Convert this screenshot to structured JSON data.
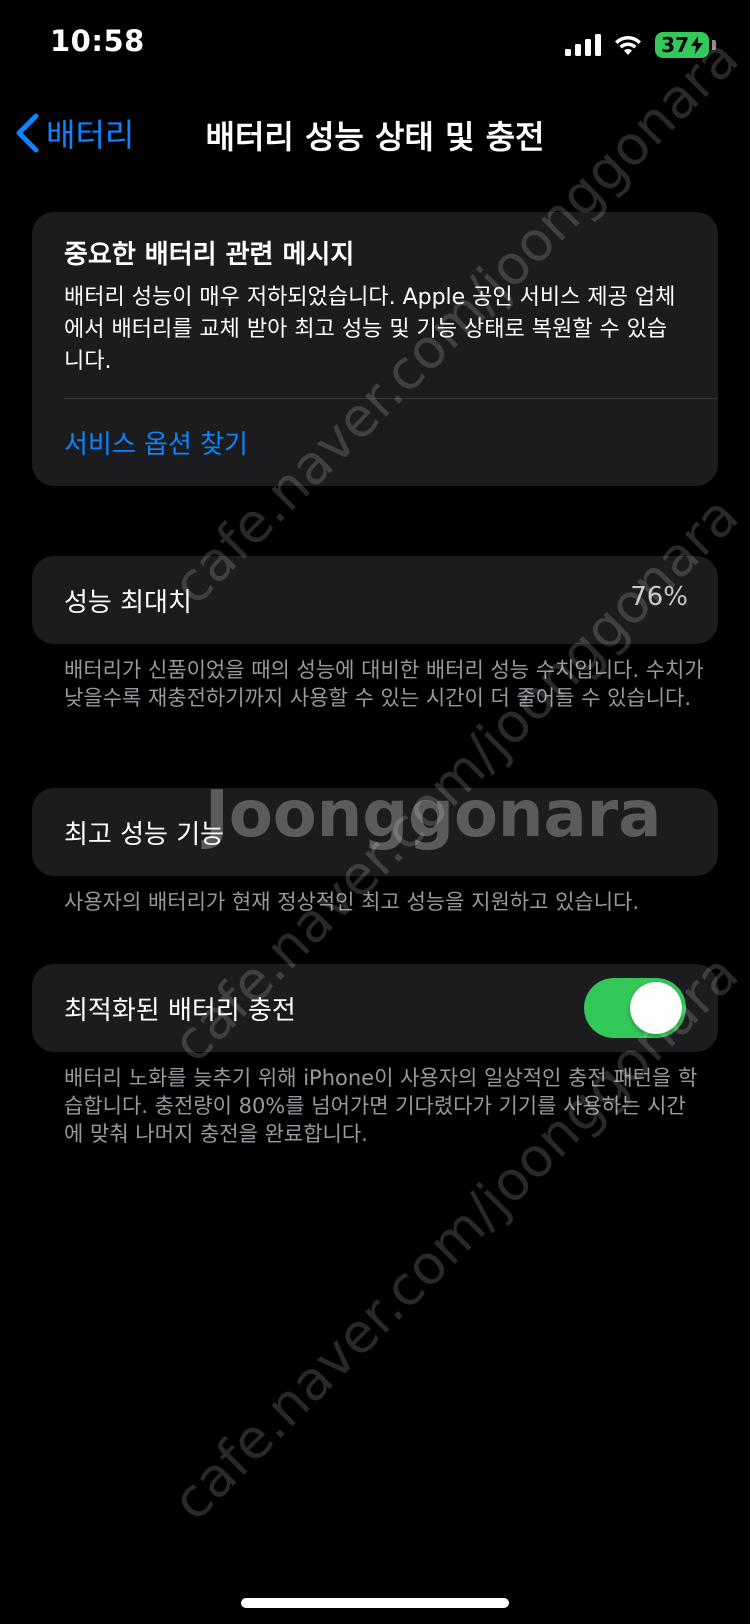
{
  "status_bar": {
    "time": "10:58",
    "battery_percent": "37"
  },
  "nav": {
    "back_label": "배터리",
    "title": "배터리 성능 상태 및 충전"
  },
  "message_card": {
    "title": "중요한 배터리 관련 메시지",
    "body": "배터리 성능이 매우 저하되었습니다. Apple 공인 서비스 제공 업체에서 배터리를 교체 받아 최고 성능 및 기능 상태로 복원할 수 있습니다.",
    "link": "서비스 옵션 찾기"
  },
  "max_capacity": {
    "label": "성능 최대치",
    "value": "76%",
    "footnote": "배터리가 신품이었을 때의 성능에 대비한 배터리 성능 수치입니다. 수치가 낮을수록 재충전하기까지 사용할 수 있는 시간이 더 줄어들 수 있습니다."
  },
  "peak_performance": {
    "label": "최고 성능 기능",
    "footnote": "사용자의 배터리가 현재 정상적인 최고 성능을 지원하고 있습니다."
  },
  "optimized_charging": {
    "label": "최적화된 배터리 충전",
    "enabled": true,
    "footnote": "배터리 노화를 늦추기 위해 iPhone이 사용자의 일상적인 충전 패턴을 학습합니다. 충전량이 80%를 넘어가면 기다렸다가 기기를 사용하는 시간에 맞춰 나머지 충전을 완료합니다."
  },
  "watermark": {
    "url_text": "cafe.naver.com/joonggonara",
    "brand_text": "Joonggonara"
  },
  "colors": {
    "accent": "#0a84ff",
    "toggle_on": "#34c759",
    "card_bg": "#1c1c1e",
    "footnote": "#98989f"
  }
}
